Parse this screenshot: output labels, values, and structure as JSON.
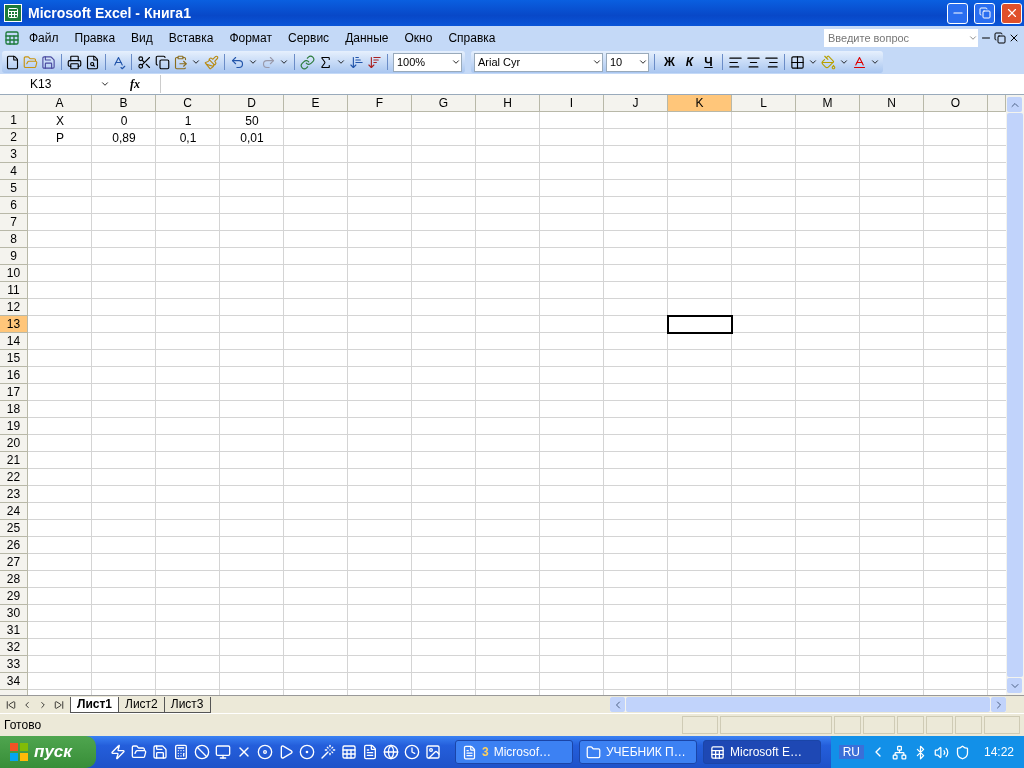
{
  "window": {
    "title": "Microsoft Excel - Книга1"
  },
  "menu": [
    "Файл",
    "Правка",
    "Вид",
    "Вставка",
    "Формат",
    "Сервис",
    "Данные",
    "Окно",
    "Справка"
  ],
  "help_search": {
    "placeholder": "Введите вопрос"
  },
  "standard_toolbar": {
    "zoom": "100%"
  },
  "formatting_toolbar": {
    "font": "Arial Cyr",
    "size": "10",
    "bold": "Ж",
    "italic": "К",
    "underline": "Ч"
  },
  "formula_bar": {
    "name_box": "K13",
    "function_label": "fx"
  },
  "sheet": {
    "columns": [
      {
        "label": "A",
        "selected": false
      },
      {
        "label": "B",
        "selected": false
      },
      {
        "label": "C",
        "selected": false
      },
      {
        "label": "D",
        "selected": false
      },
      {
        "label": "E",
        "selected": false
      },
      {
        "label": "F",
        "selected": false
      },
      {
        "label": "G",
        "selected": false
      },
      {
        "label": "H",
        "selected": false
      },
      {
        "label": "I",
        "selected": false
      },
      {
        "label": "J",
        "selected": false
      },
      {
        "label": "K",
        "selected": true
      },
      {
        "label": "L",
        "selected": false
      },
      {
        "label": "M",
        "selected": false
      },
      {
        "label": "N",
        "selected": false
      },
      {
        "label": "O",
        "selected": false
      }
    ],
    "rows": [
      {
        "label": "1",
        "selected": false,
        "cells": [
          "X",
          "0",
          "1",
          "50"
        ]
      },
      {
        "label": "2",
        "selected": false,
        "cells": [
          "P",
          "0,89",
          "0,1",
          "0,01"
        ]
      },
      {
        "label": "3",
        "selected": false,
        "cells": []
      },
      {
        "label": "4",
        "selected": false,
        "cells": []
      },
      {
        "label": "5",
        "selected": false,
        "cells": []
      },
      {
        "label": "6",
        "selected": false,
        "cells": []
      },
      {
        "label": "7",
        "selected": false,
        "cells": []
      },
      {
        "label": "8",
        "selected": false,
        "cells": []
      },
      {
        "label": "9",
        "selected": false,
        "cells": []
      },
      {
        "label": "10",
        "selected": false,
        "cells": []
      },
      {
        "label": "11",
        "selected": false,
        "cells": []
      },
      {
        "label": "12",
        "selected": false,
        "cells": []
      },
      {
        "label": "13",
        "selected": true,
        "cells": []
      },
      {
        "label": "14",
        "selected": false,
        "cells": []
      },
      {
        "label": "15",
        "selected": false,
        "cells": []
      },
      {
        "label": "16",
        "selected": false,
        "cells": []
      },
      {
        "label": "17",
        "selected": false,
        "cells": []
      },
      {
        "label": "18",
        "selected": false,
        "cells": []
      },
      {
        "label": "19",
        "selected": false,
        "cells": []
      },
      {
        "label": "20",
        "selected": false,
        "cells": []
      },
      {
        "label": "21",
        "selected": false,
        "cells": []
      },
      {
        "label": "22",
        "selected": false,
        "cells": []
      },
      {
        "label": "23",
        "selected": false,
        "cells": []
      },
      {
        "label": "24",
        "selected": false,
        "cells": []
      },
      {
        "label": "25",
        "selected": false,
        "cells": []
      },
      {
        "label": "26",
        "selected": false,
        "cells": []
      },
      {
        "label": "27",
        "selected": false,
        "cells": []
      },
      {
        "label": "28",
        "selected": false,
        "cells": []
      },
      {
        "label": "29",
        "selected": false,
        "cells": []
      },
      {
        "label": "30",
        "selected": false,
        "cells": []
      },
      {
        "label": "31",
        "selected": false,
        "cells": []
      },
      {
        "label": "32",
        "selected": false,
        "cells": []
      },
      {
        "label": "33",
        "selected": false,
        "cells": []
      },
      {
        "label": "34",
        "selected": false,
        "cells": []
      }
    ]
  },
  "sheet_tabs": [
    {
      "label": "Лист1",
      "selected": true
    },
    {
      "label": "Лист2",
      "selected": false
    },
    {
      "label": "Лист3",
      "selected": false
    }
  ],
  "status_bar": {
    "text": "Готово"
  },
  "taskbar": {
    "start": "пуск",
    "tasks": [
      {
        "kind": "word",
        "count": "3",
        "label": "Microsof…",
        "selected": false
      },
      {
        "kind": "folder",
        "label": "УЧЕБНИК П…",
        "selected": false
      },
      {
        "kind": "excel",
        "label": "Microsoft E…",
        "selected": true
      }
    ],
    "language": "RU",
    "clock": "14:22"
  }
}
